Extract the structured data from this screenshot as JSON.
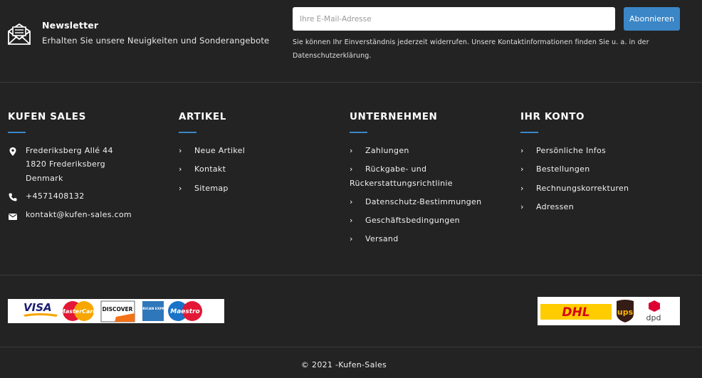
{
  "newsletter": {
    "title": "Newsletter",
    "subtitle": "Erhalten Sie unsere Neuigkeiten und Sonderangebote",
    "email_placeholder": "Ihre E-Mail-Adresse",
    "subscribe_label": "Abonnieren",
    "consent": "Sie können Ihr Einverständnis jederzeit widerrufen. Unsere Kontaktinformationen finden Sie u. a. in der Datenschutzerklärung.",
    "icon": "mail-envelope-icon"
  },
  "columns": {
    "company": {
      "title": "KUFEN SALES",
      "address_line1": "Frederiksberg Allé 44",
      "address_line2": "1820 Frederiksberg",
      "address_line3": "Denmark",
      "phone": "+4571408132",
      "email": "kontakt@kufen-sales.com"
    },
    "articles": {
      "title": "ARTIKEL",
      "items": [
        "Neue Artikel",
        "Kontakt",
        "Sitemap"
      ]
    },
    "company_info": {
      "title": "UNTERNEHMEN",
      "items": [
        "Zahlungen",
        "Rückgabe- und",
        "Rückerstattungsrichtlinie",
        "Datenschutz-Bestimmungen",
        "Geschäftsbedingungen",
        "Versand"
      ]
    },
    "account": {
      "title": "IHR KONTO",
      "items": [
        "Persönliche Infos",
        "Bestellungen",
        "Rechnungskorrekturen",
        "Adressen"
      ]
    }
  },
  "payment_logos": [
    "VISA",
    "MasterCard",
    "DISCOVER",
    "AMERICAN EXPRESS",
    "Maestro"
  ],
  "shipping_logos": [
    "DHL",
    "ups",
    "dpd"
  ],
  "copyright": "© 2021 -Kufen-Sales",
  "colors": {
    "background": "#232323",
    "accent": "#3b86c6"
  }
}
